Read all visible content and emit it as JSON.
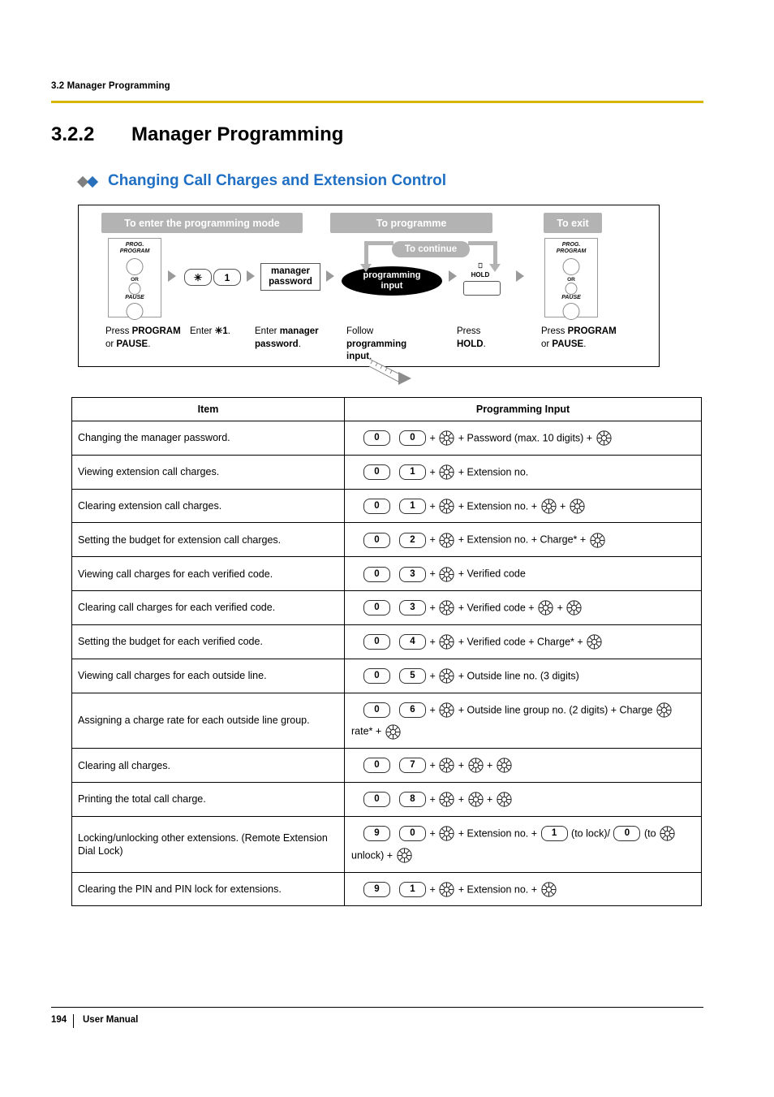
{
  "header": {
    "section_label": "3.2 Manager Programming"
  },
  "title": {
    "number": "3.2.2",
    "text": "Manager Programming",
    "subtitle": "Changing Call Charges and Extension Control"
  },
  "flow": {
    "step_enter": "To enter the programming mode",
    "step_programme": "To programme",
    "step_exit": "To exit",
    "step_continue": "To continue",
    "phone1": {
      "prog_line1": "PROG.",
      "prog_line2": "PROGRAM",
      "or": "OR",
      "pause": "PAUSE"
    },
    "phone2": {
      "prog_line1": "PROG.",
      "prog_line2": "PROGRAM",
      "or": "OR",
      "pause": "PAUSE"
    },
    "key_star": "✳",
    "key_one": "1",
    "manager_password_box": "manager\npassword",
    "programming_input_box": "programming\ninput",
    "hold_label": "HOLD",
    "captions": {
      "c1_line1": "Press PROGRAM",
      "c1_line2": "or PAUSE.",
      "c2": "Enter ✳ 1.",
      "c3_line1": "Enter manager",
      "c3_line2": "password.",
      "c4_line1": "Follow",
      "c4_line2": "programming",
      "c4_line3": "input.",
      "c5_line1": "Press",
      "c5_line2": "HOLD.",
      "c6_line1": "Press PROGRAM",
      "c6_line2": "or PAUSE."
    }
  },
  "table": {
    "headers": {
      "item": "Item",
      "input": "Programming Input"
    },
    "rows": [
      {
        "item": "Changing the manager password.",
        "keys": [
          "0",
          "0"
        ],
        "tail": "+ Password (max. 10 digits) +",
        "tail_auto_end": true
      },
      {
        "item": "Viewing extension call charges.",
        "keys": [
          "0",
          "1"
        ],
        "tail": "+ Extension no.",
        "tail_auto_end": false
      },
      {
        "item": "Clearing extension call charges.",
        "keys": [
          "0",
          "1"
        ],
        "tail": "+ Extension no. +",
        "tail_auto_end": true,
        "tail_auto_double": true
      },
      {
        "item": "Setting the budget for extension call charges.",
        "keys": [
          "0",
          "2"
        ],
        "tail": "+ Extension no. + Charge* +",
        "tail_auto_end": true
      },
      {
        "item": "Viewing call charges for each verified code.",
        "keys": [
          "0",
          "3"
        ],
        "tail": "+ Verified code",
        "tail_auto_end": false
      },
      {
        "item": "Clearing call charges for each verified code.",
        "keys": [
          "0",
          "3"
        ],
        "tail": "+ Verified code +",
        "tail_auto_end": true,
        "tail_auto_double": true
      },
      {
        "item": "Setting the budget for each verified code.",
        "keys": [
          "0",
          "4"
        ],
        "tail": "+ Verified code + Charge* +",
        "tail_auto_end": true
      },
      {
        "item": "Viewing call charges for each outside line.",
        "keys": [
          "0",
          "5"
        ],
        "tail": "+ Outside line no. (3 digits)",
        "tail_auto_end": false
      },
      {
        "item": "Assigning a charge rate for each outside line group.",
        "keys": [
          "0",
          "6"
        ],
        "tail": "+ Outside line group no. (2 digits) + Charge",
        "tail2": "rate* +",
        "tail_auto_end": true
      },
      {
        "item": "Clearing all charges.",
        "keys": [
          "0",
          "7"
        ],
        "tail": "+",
        "tail_auto_end": true,
        "tail_auto_double_simple": true
      },
      {
        "item": "Printing the total call charge.",
        "keys": [
          "0",
          "8"
        ],
        "tail": "+",
        "tail_auto_end": true,
        "tail_auto_double_simple": true
      },
      {
        "item": "Locking/unlocking other extensions. (Remote Extension Dial Lock)",
        "keys": [
          "9",
          "0"
        ],
        "tail": "+ Extension no. +",
        "lock_key": "1",
        "lock_text": "(to lock)/",
        "unlock_key": "0",
        "unlock_text": "(to",
        "tail2": "unlock) +",
        "tail_auto_end": true
      },
      {
        "item": "Clearing the PIN and PIN lock for extensions.",
        "keys": [
          "9",
          "1"
        ],
        "tail": "+ Extension no. +",
        "tail_auto_end": true
      }
    ]
  },
  "footer": {
    "page_number": "194",
    "doc_label": "User Manual"
  }
}
